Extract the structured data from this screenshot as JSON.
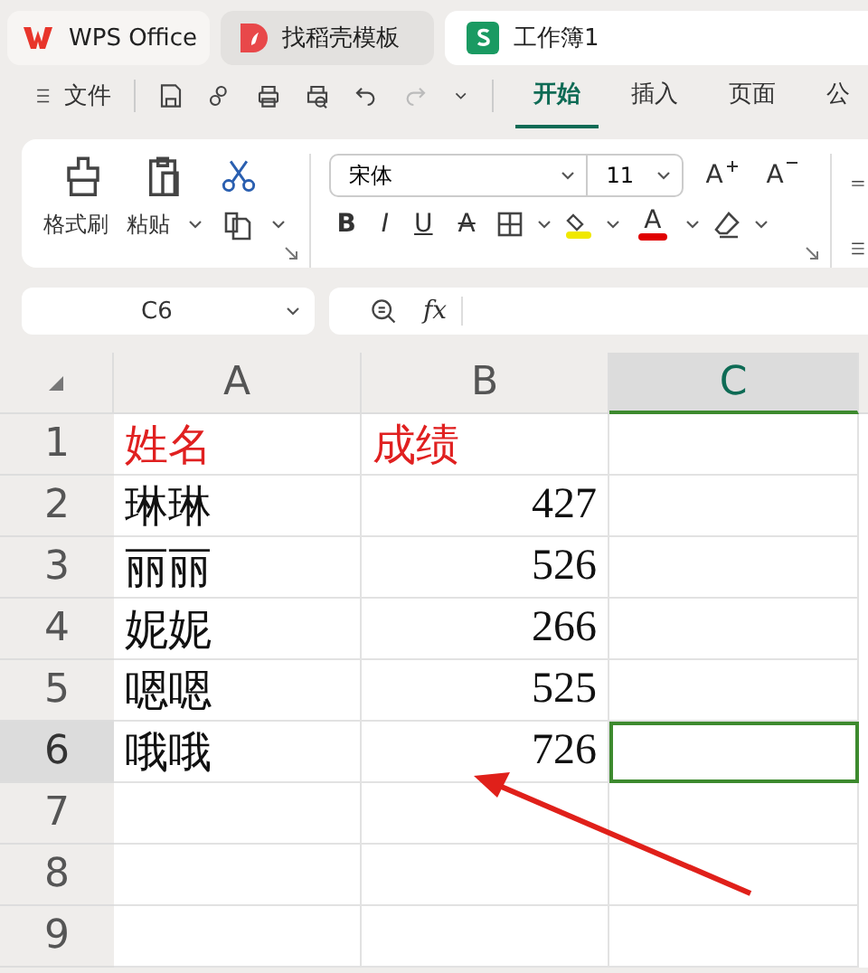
{
  "tabs": [
    {
      "kind": "wps",
      "label": "WPS Office",
      "selected": false
    },
    {
      "kind": "docer",
      "label": "找稻壳模板",
      "selected": false
    },
    {
      "kind": "sheet",
      "label": "工作簿1",
      "selected": true
    }
  ],
  "menu": {
    "label": "文件"
  },
  "ribbon_tabs": [
    {
      "label": "开始",
      "selected": true
    },
    {
      "label": "插入",
      "selected": false
    },
    {
      "label": "页面",
      "selected": false
    },
    {
      "label": "公",
      "selected": false
    }
  ],
  "clipboard": {
    "format_painter": "格式刷",
    "paste": "粘贴"
  },
  "font": {
    "family": "宋体",
    "size": "11",
    "grow": "A",
    "shrink": "A"
  },
  "format_buttons": [
    {
      "kind": "bold",
      "text": "B"
    },
    {
      "kind": "italic",
      "text": "I"
    },
    {
      "kind": "underline",
      "text": "U"
    },
    {
      "kind": "strike",
      "text": "A"
    }
  ],
  "font_color": {
    "text": "A",
    "color": "#e00000"
  },
  "fill_color": {
    "color": "#f0e800"
  },
  "name_box": {
    "value": "C6"
  },
  "formula": {
    "icon_text": "fx"
  },
  "columns": [
    {
      "label": "A",
      "selected": false
    },
    {
      "label": "B",
      "selected": false
    },
    {
      "label": "C",
      "selected": true
    }
  ],
  "rows": [
    {
      "number": "1",
      "selected": false,
      "cells": [
        {
          "kind": "text",
          "text": "姓名",
          "color": "#e02020"
        },
        {
          "kind": "text",
          "text": "成绩",
          "color": "#e02020"
        },
        {
          "kind": "empty",
          "selected": false
        }
      ]
    },
    {
      "number": "2",
      "selected": false,
      "cells": [
        {
          "kind": "text",
          "text": "琳琳"
        },
        {
          "kind": "number",
          "text": "427"
        },
        {
          "kind": "empty",
          "selected": false
        }
      ]
    },
    {
      "number": "3",
      "selected": false,
      "cells": [
        {
          "kind": "text",
          "text": "丽丽"
        },
        {
          "kind": "number",
          "text": "526"
        },
        {
          "kind": "empty",
          "selected": false
        }
      ]
    },
    {
      "number": "4",
      "selected": false,
      "cells": [
        {
          "kind": "text",
          "text": "妮妮"
        },
        {
          "kind": "number",
          "text": "266"
        },
        {
          "kind": "empty",
          "selected": false
        }
      ]
    },
    {
      "number": "5",
      "selected": false,
      "cells": [
        {
          "kind": "text",
          "text": "嗯嗯"
        },
        {
          "kind": "number",
          "text": "525"
        },
        {
          "kind": "empty",
          "selected": false
        }
      ]
    },
    {
      "number": "6",
      "selected": true,
      "cells": [
        {
          "kind": "text",
          "text": "哦哦"
        },
        {
          "kind": "number",
          "text": "726"
        },
        {
          "kind": "empty",
          "selected": true
        }
      ]
    },
    {
      "number": "7",
      "selected": false,
      "cells": [
        {
          "kind": "empty",
          "selected": false
        },
        {
          "kind": "empty",
          "selected": false
        },
        {
          "kind": "empty",
          "selected": false
        }
      ]
    },
    {
      "number": "8",
      "selected": false,
      "cells": [
        {
          "kind": "empty",
          "selected": false
        },
        {
          "kind": "empty",
          "selected": false
        },
        {
          "kind": "empty",
          "selected": false
        }
      ]
    },
    {
      "number": "9",
      "selected": false,
      "cells": [
        {
          "kind": "empty",
          "selected": false
        },
        {
          "kind": "empty",
          "selected": false
        },
        {
          "kind": "empty",
          "selected": false
        }
      ]
    }
  ]
}
